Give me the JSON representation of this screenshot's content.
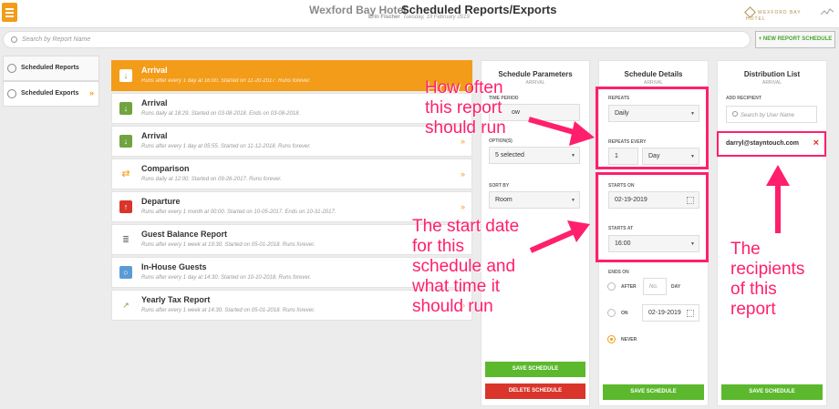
{
  "header": {
    "hotel_name": "Wexford Bay Hotel",
    "page_title": "Scheduled Reports/Exports",
    "user": "Erin Fischer",
    "date": "Tuesday, 19 February 2019",
    "brand": "WEXFORD BAY HOTEL"
  },
  "search": {
    "placeholder": "Search by Report Name"
  },
  "new_schedule_label": "+ NEW REPORT SCHEDULE",
  "sidebar": {
    "items": [
      {
        "label": "Scheduled Reports"
      },
      {
        "label": "Scheduled Exports"
      }
    ]
  },
  "reports": [
    {
      "name": "Arrival",
      "desc": "Runs after every 1 day at 16:00. Started on 11-20-2017. Runs forever.",
      "icon": "arrow-down-icon"
    },
    {
      "name": "Arrival",
      "desc": "Runs daily at 18:29. Started on 03-08-2018. Ends on 03-08-2018.",
      "icon": "arrow-down-icon"
    },
    {
      "name": "Arrival",
      "desc": "Runs after every 1 day at 05:55. Started on 11-12-2018. Runs forever.",
      "icon": "arrow-down-icon"
    },
    {
      "name": "Comparison",
      "desc": "Runs daily at 12:00. Started on 09-26-2017. Runs forever.",
      "icon": "swap-icon"
    },
    {
      "name": "Departure",
      "desc": "Runs after every 1 month at 00:00. Started on 10-05-2017. Ends on 10-31-2017.",
      "icon": "arrow-up-icon"
    },
    {
      "name": "Guest Balance Report",
      "desc": "Runs after every 1 week at 19:30. Started on 05-01-2018. Runs forever.",
      "icon": "coins-icon"
    },
    {
      "name": "In-House Guests",
      "desc": "Runs after every 1 day at 14:30. Started on 10-10-2018. Runs forever.",
      "icon": "circle-icon"
    },
    {
      "name": "Yearly Tax Report",
      "desc": "Runs after every 1 week at 14:30. Started on 05-01-2018. Runs forever.",
      "icon": "trend-icon"
    }
  ],
  "params": {
    "title": "Schedule Parameters",
    "subtitle": "ARRIVAL",
    "time_period_label": "TIME PERIOD",
    "time_period_value": "ow",
    "options_label": "OPTION(S)",
    "options_value": "5 selected",
    "sort_label": "SORT BY",
    "sort_value": "Room",
    "save": "SAVE SCHEDULE",
    "delete": "DELETE SCHEDULE"
  },
  "details": {
    "title": "Schedule Details",
    "subtitle": "ARRIVAL",
    "repeats_label": "REPEATS",
    "repeats_value": "Daily",
    "every_label": "REPEATS EVERY",
    "every_num": "1",
    "every_unit": "Day",
    "starts_on_label": "STARTS ON",
    "starts_on_value": "02-19-2019",
    "starts_at_label": "STARTS AT",
    "starts_at_value": "16:00",
    "ends_on_label": "ENDS ON",
    "after_label": "AFTER",
    "after_placeholder": "No.",
    "day_label": "DAY",
    "on_label": "ON",
    "on_value": "02-19-2019",
    "never_label": "NEVER",
    "save": "SAVE SCHEDULE"
  },
  "distribution": {
    "title": "Distribution List",
    "subtitle": "ARRIVAL",
    "add_label": "ADD RECIPIENT",
    "search_placeholder": "Search by User Name",
    "recipient": "darryl@stayntouch.com",
    "save": "SAVE SCHEDULE"
  },
  "annotations": {
    "how_often": "How often this report should run",
    "start": "The start date for this schedule and what time it should run",
    "recipients": "The recipients of this report"
  },
  "colors": {
    "accent": "#f39c19",
    "annotation": "#ff1f6d",
    "save": "#5cb82c",
    "delete": "#d9352a"
  }
}
